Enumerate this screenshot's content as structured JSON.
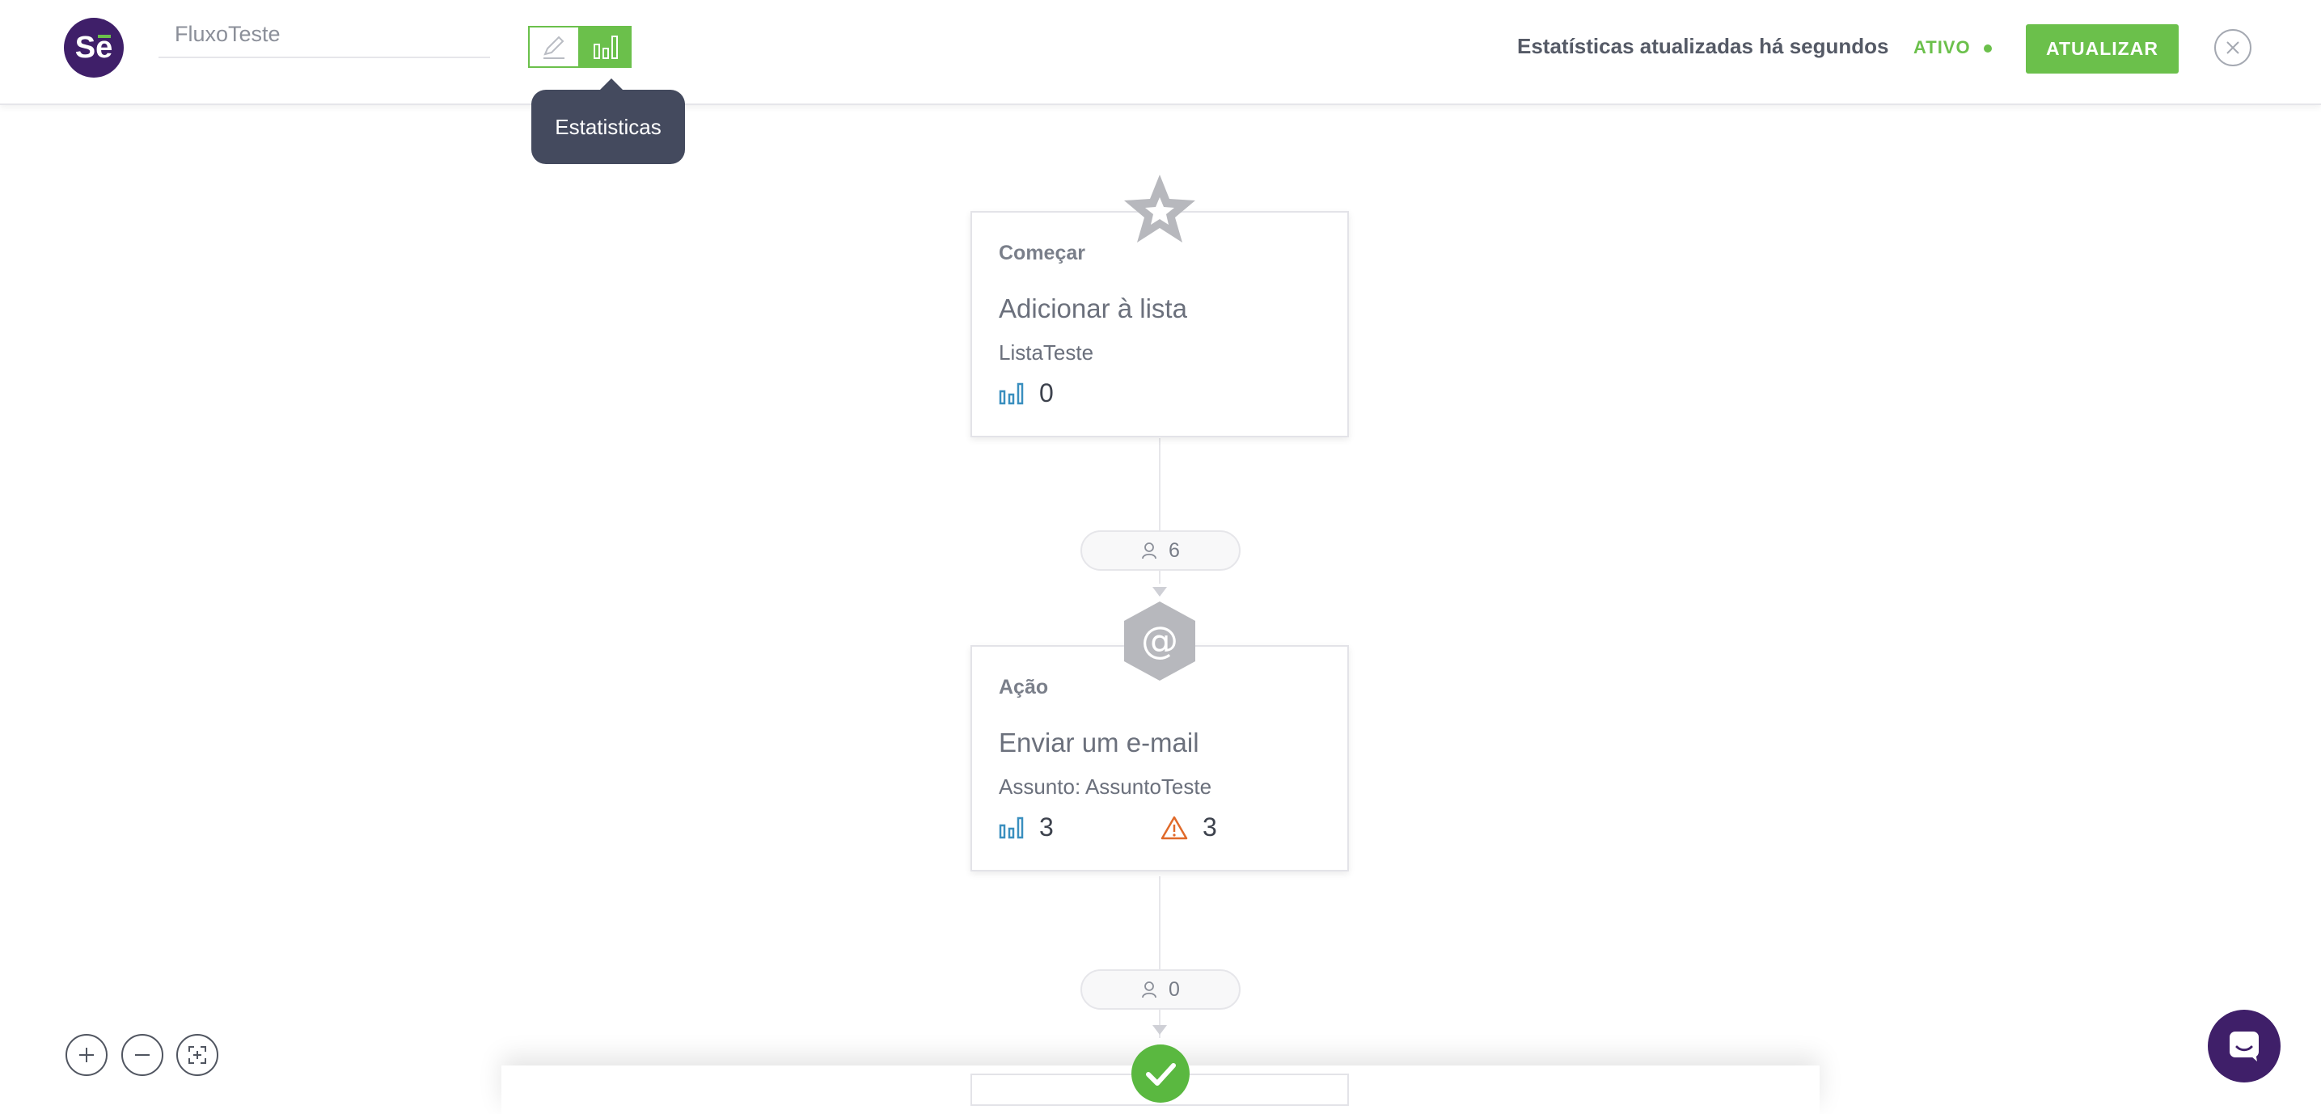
{
  "header": {
    "logo_text": "Se",
    "flow_name": "FluxoTeste",
    "modes": [
      {
        "name": "editar",
        "icon": "pencil-icon",
        "active": false
      },
      {
        "name": "estatisticas",
        "icon": "bar-chart-icon",
        "active": true
      }
    ],
    "tooltip": "Estatisticas",
    "stats_updated": "Estatísticas atualizadas há segundos",
    "status": "ATIVO",
    "update_button": "ATUALIZAR",
    "close_icon": "close-icon"
  },
  "flow": {
    "nodes": [
      {
        "icon": "star-icon",
        "type": "Começar",
        "title": "Adicionar à lista",
        "subtitle": "ListaTeste",
        "stats": [
          {
            "icon": "bar-chart-icon",
            "value": "0"
          }
        ]
      },
      {
        "icon": "at-sign-icon",
        "type": "Ação",
        "title": "Enviar um e-mail",
        "subtitle": "Assunto: AssuntoTeste",
        "stats": [
          {
            "icon": "bar-chart-icon",
            "value": "3"
          },
          {
            "icon": "warning-icon",
            "value": "3"
          }
        ]
      },
      {
        "icon": "check-icon"
      }
    ],
    "connectors": [
      {
        "icon": "user-icon",
        "count": "6"
      },
      {
        "icon": "user-icon",
        "count": "0"
      }
    ]
  },
  "zoom_controls": [
    "zoom-in-icon",
    "zoom-out-icon",
    "fit-screen-icon"
  ],
  "chat": {
    "icon": "chat-icon"
  },
  "colors": {
    "brand": "#3f1f69",
    "accent": "#6bc04b",
    "tooltip_bg": "#444a5e",
    "stat_blue": "#3a8fbf",
    "warning": "#e06a2a"
  }
}
